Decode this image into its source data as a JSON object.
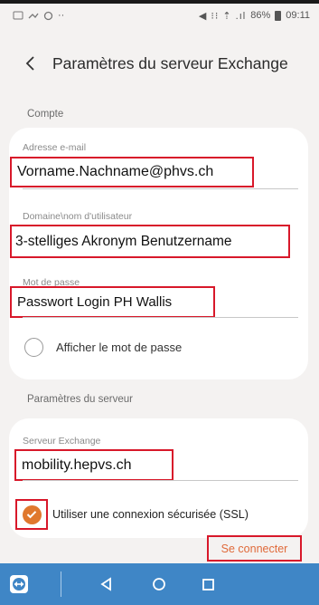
{
  "status_bar": {
    "left_icons": [
      "sim-icon",
      "cast-icon",
      "dots-icon"
    ],
    "battery": "86%",
    "time": "09:11"
  },
  "header": {
    "title": "Paramètres du serveur Exchange"
  },
  "account_section": {
    "label": "Compte",
    "email_label": "Adresse e-mail",
    "email_value": "Vorname.Nachname@phvs.ch",
    "username_label": "Domaine\\nom d'utilisateur",
    "username_value": "3-stelliges Akronym Benutzername",
    "password_label": "Mot de passe",
    "password_value": "Passwort Login PH Wallis",
    "show_password_label": "Afficher le mot de passe"
  },
  "server_section": {
    "label": "Paramètres du serveur",
    "server_label": "Serveur Exchange",
    "server_value": "mobility.hepvs.ch",
    "ssl_label": "Utiliser une connexion sécurisée (SSL)",
    "ssl_checked": true
  },
  "connect_label": "Se connecter",
  "colors": {
    "accent": "#e0782e",
    "annotation": "#d8182a",
    "navbar": "#3f86c6"
  }
}
